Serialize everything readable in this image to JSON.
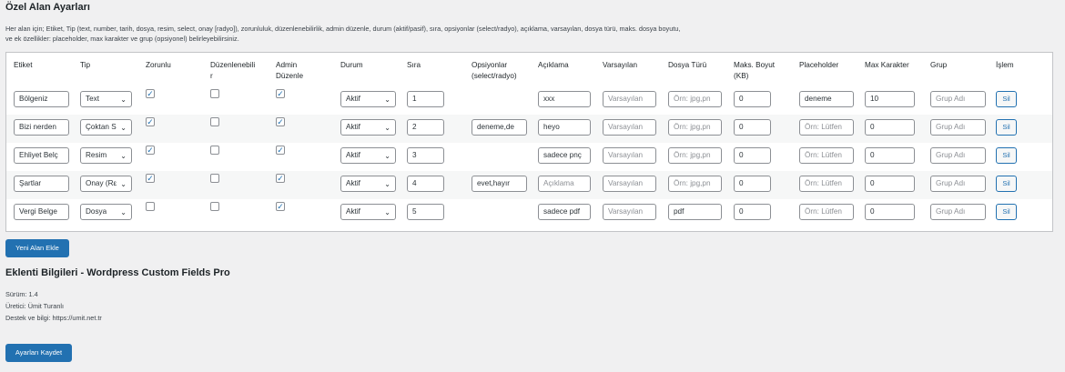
{
  "page_title": "Özel Alan Ayarları",
  "description": [
    "Her alan için; Etiket, Tip (text, number, tarih, dosya, resim, select, onay [radyo]), zorunluluk, düzenlenebilirlik, admin düzenle, durum (aktif/pasif), sıra, opsiyonlar (select/radyo), açıklama, varsayılan, dosya türü, maks. dosya boyutu,",
    "ve ek özellikler: placeholder, max karakter ve grup (opsiyonel) belirleyebilirsiniz."
  ],
  "table": {
    "headers": {
      "etiket": "Etiket",
      "tip": "Tip",
      "zorunlu": "Zorunlu",
      "duzenlenebilir_1": "Düzenlenebili",
      "duzenlenebilir_2": "r",
      "admin_1": "Admin",
      "admin_2": "Düzenle",
      "durum": "Durum",
      "sira": "Sıra",
      "opsiyonlar_1": "Opsiyonlar",
      "opsiyonlar_2": "(select/radyo)",
      "aciklama": "Açıklama",
      "varsayilan": "Varsayılan",
      "dosya_turu": "Dosya Türü",
      "maks_1": "Maks. Boyut",
      "maks_2": "(KB)",
      "placeholder": "Placeholder",
      "max_karakter": "Max Karakter",
      "grup": "Grup",
      "islem": "İşlem"
    },
    "rows": [
      {
        "etiket": "Bölgeniz",
        "tip": "Text",
        "zorunlu": true,
        "duzenlenebilir": false,
        "admin": true,
        "durum": "Aktif",
        "sira": "1",
        "opsiyonlar": "",
        "aciklama": "xxx",
        "varsayilan": "Varsayılan",
        "dosya_turu": "Örn: jpg,pn",
        "maks": "0",
        "placeholder": "deneme",
        "max_karakter": "10",
        "grup": "Grup Adı",
        "sil": "Sil"
      },
      {
        "etiket": "Bizi nerden",
        "tip": "Çoktan S",
        "zorunlu": true,
        "duzenlenebilir": false,
        "admin": true,
        "durum": "Aktif",
        "sira": "2",
        "opsiyonlar": "deneme,de",
        "aciklama": "heyo",
        "varsayilan": "Varsayılan",
        "dosya_turu": "Örn: jpg,pn",
        "maks": "0",
        "placeholder": "Örn: Lütfen",
        "max_karakter": "0",
        "grup": "Grup Adı",
        "sil": "Sil"
      },
      {
        "etiket": "Ehliyet Belç",
        "tip": "Resim",
        "zorunlu": true,
        "duzenlenebilir": false,
        "admin": true,
        "durum": "Aktif",
        "sira": "3",
        "opsiyonlar": "",
        "aciklama": "sadece pnç",
        "varsayilan": "Varsayılan",
        "dosya_turu": "Örn: jpg,pn",
        "maks": "0",
        "placeholder": "Örn: Lütfen",
        "max_karakter": "0",
        "grup": "Grup Adı",
        "sil": "Sil"
      },
      {
        "etiket": "Şartlar",
        "tip": "Onay (Rε",
        "zorunlu": true,
        "duzenlenebilir": false,
        "admin": true,
        "durum": "Aktif",
        "sira": "4",
        "opsiyonlar": "evet,hayır",
        "aciklama": "Açıklama",
        "varsayilan": "Varsayılan",
        "dosya_turu": "Örn: jpg,pn",
        "maks": "0",
        "placeholder": "Örn: Lütfen",
        "max_karakter": "0",
        "grup": "Grup Adı",
        "sil": "Sil"
      },
      {
        "etiket": "Vergi Belge",
        "tip": "Dosya",
        "zorunlu": false,
        "duzenlenebilir": false,
        "admin": true,
        "durum": "Aktif",
        "sira": "5",
        "opsiyonlar": "",
        "aciklama": "sadece pdf",
        "varsayilan": "Varsayılan",
        "dosya_turu": "pdf",
        "maks": "0",
        "placeholder": "Örn: Lütfen",
        "max_karakter": "0",
        "grup": "Grup Adı",
        "sil": "Sil"
      }
    ],
    "placeholder_fields": [
      "aciklama_Açıklama",
      "varsayilan",
      "dosya_turu_Örn",
      "placeholder_Örn",
      "grup"
    ]
  },
  "add_field_button": "Yeni Alan Ekle",
  "info": {
    "title": "Eklenti Bilgileri - Wordpress Custom Fields Pro",
    "version": "Sürüm: 1.4",
    "author": "Üretici: Ümit Turanlı",
    "support": "Destek ve bilgi: https://umit.net.tr"
  },
  "save_button": "Ayarları Kaydet",
  "icons": {
    "checkbox_checked": "checkmark-icon",
    "select_arrow": "chevron-down-icon"
  },
  "colors": {
    "primary": "#2271b1",
    "background": "#f0f0f1",
    "border": "#8c8f94"
  }
}
